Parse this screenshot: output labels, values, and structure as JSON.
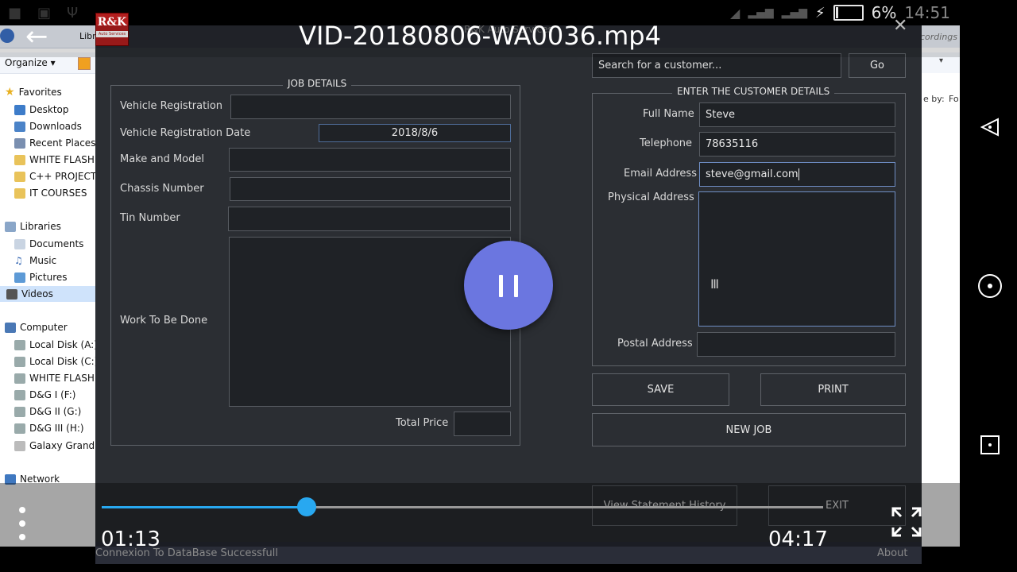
{
  "explorer": {
    "breadcrumb_fragment": "Libr",
    "organize_label": "Organize ▾",
    "favorites_label": "Favorites",
    "favorites": [
      "Desktop",
      "Downloads",
      "Recent Places",
      "WHITE FLASH (",
      "C++ PROJECTS",
      "IT COURSES"
    ],
    "libraries_label": "Libraries",
    "libraries": [
      "Documents",
      "Music",
      "Pictures",
      "Videos"
    ],
    "computer_label": "Computer",
    "drives": [
      "Local Disk (A:)",
      "Local Disk (C:)",
      "WHITE FLASH (",
      "D&G I (F:)",
      "D&G II (G:)",
      "D&G III (H:)",
      "Galaxy Grand P"
    ],
    "network_label": "Network",
    "right_fragment_recordings": "cordings",
    "right_fragment_sort": "e by:",
    "right_fragment_fo": "Fo"
  },
  "statusbar": {
    "battery": "6%",
    "time": "14:51"
  },
  "app": {
    "window_title": "R&K Auto Services",
    "logo_text": "R&K",
    "logo_caption": "Auto Services",
    "job_details": {
      "title": "JOB DETAILS",
      "vehicle_registration_label": "Vehicle Registration",
      "vehicle_registration_value": "",
      "registration_date_label": "Vehicle Registration Date",
      "registration_date_value": "2018/8/6",
      "make_model_label": "Make and Model",
      "make_model_value": "",
      "chassis_label": "Chassis Number",
      "chassis_value": "",
      "tin_label": "Tin Number",
      "tin_value": "",
      "work_label": "Work To Be Done",
      "work_value": "",
      "total_price_label": "Total Price",
      "total_price_value": ""
    },
    "search": {
      "placeholder": "Search for a customer...",
      "go_label": "Go"
    },
    "customer": {
      "title": "ENTER THE CUSTOMER DETAILS",
      "full_name_label": "Full Name",
      "full_name_value": "Steve",
      "telephone_label": "Telephone",
      "telephone_value": "78635116",
      "email_label": "Email Address",
      "email_value": "steve@gmail.com",
      "physical_label": "Physical Address",
      "physical_value": "",
      "postal_label": "Postal Address",
      "postal_value": ""
    },
    "buttons": {
      "save": "SAVE",
      "print": "PRINT",
      "new_job": "NEW JOB",
      "statement_history": "View Statement History",
      "exit": "EXIT"
    },
    "status_text": "Connexion To DataBase Successfull",
    "about_label": "About"
  },
  "player": {
    "title": "VID-20180806-WA0036.mp4",
    "current_time": "01:13",
    "total_time": "04:17",
    "progress_fraction": 0.284
  },
  "colors": {
    "accent_blue": "#28a8f0",
    "pause_button": "#6b76e0",
    "app_background": "#2b2e33"
  }
}
